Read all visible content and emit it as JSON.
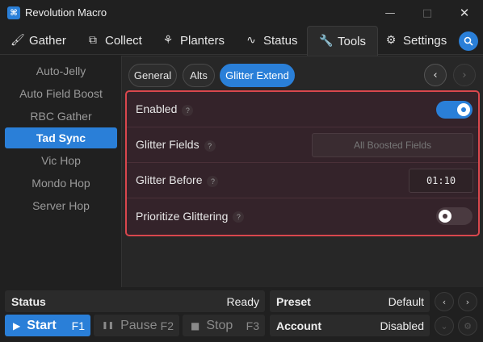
{
  "window": {
    "title": "Revolution Macro",
    "icon_glyph": "⌘",
    "minimize": "—",
    "maximize": "□",
    "close": "✕"
  },
  "topnav": [
    {
      "label": "Gather",
      "icon": "🖌"
    },
    {
      "label": "Collect",
      "icon": "⧉"
    },
    {
      "label": "Planters",
      "icon": "⚘"
    },
    {
      "label": "Status",
      "icon": "∿"
    },
    {
      "label": "Tools",
      "icon": "🔧"
    },
    {
      "label": "Settings",
      "icon": "⚙"
    }
  ],
  "sidebar": {
    "items": [
      {
        "label": "Auto-Jelly"
      },
      {
        "label": "Auto Field Boost"
      },
      {
        "label": "RBC Gather"
      },
      {
        "label": "Tad Sync"
      },
      {
        "label": "Vic Hop"
      },
      {
        "label": "Mondo Hop"
      },
      {
        "label": "Server Hop"
      }
    ],
    "active_index": 3
  },
  "subtabs": [
    {
      "label": "General"
    },
    {
      "label": "Alts"
    },
    {
      "label": "Glitter Extend"
    }
  ],
  "nav_arrows": {
    "prev": "‹",
    "next": "›"
  },
  "settings": {
    "enabled": {
      "label": "Enabled",
      "help": "?",
      "value": true
    },
    "glitter_fields": {
      "label": "Glitter Fields",
      "help": "?",
      "value": "All Boosted Fields"
    },
    "glitter_before": {
      "label": "Glitter Before",
      "help": "?",
      "value": "01:10"
    },
    "prioritize": {
      "label": "Prioritize Glittering",
      "help": "?",
      "value": false
    }
  },
  "bottom": {
    "status": {
      "label": "Status",
      "value": "Ready"
    },
    "preset": {
      "label": "Preset",
      "value": "Default"
    },
    "account": {
      "label": "Account",
      "value": "Disabled"
    },
    "start": {
      "label": "Start",
      "key": "F1",
      "glyph": "▶"
    },
    "pause": {
      "label": "Pause",
      "key": "F2",
      "glyph": "❚❚"
    },
    "stop": {
      "label": "Stop",
      "key": "F3",
      "glyph": "■"
    },
    "arrows": {
      "left": "‹",
      "right": "›",
      "down": "⌄",
      "gear": "⚙"
    }
  },
  "colors": {
    "accent": "#2a7fd8",
    "highlight_border": "#d9474d",
    "background": "#202020"
  }
}
